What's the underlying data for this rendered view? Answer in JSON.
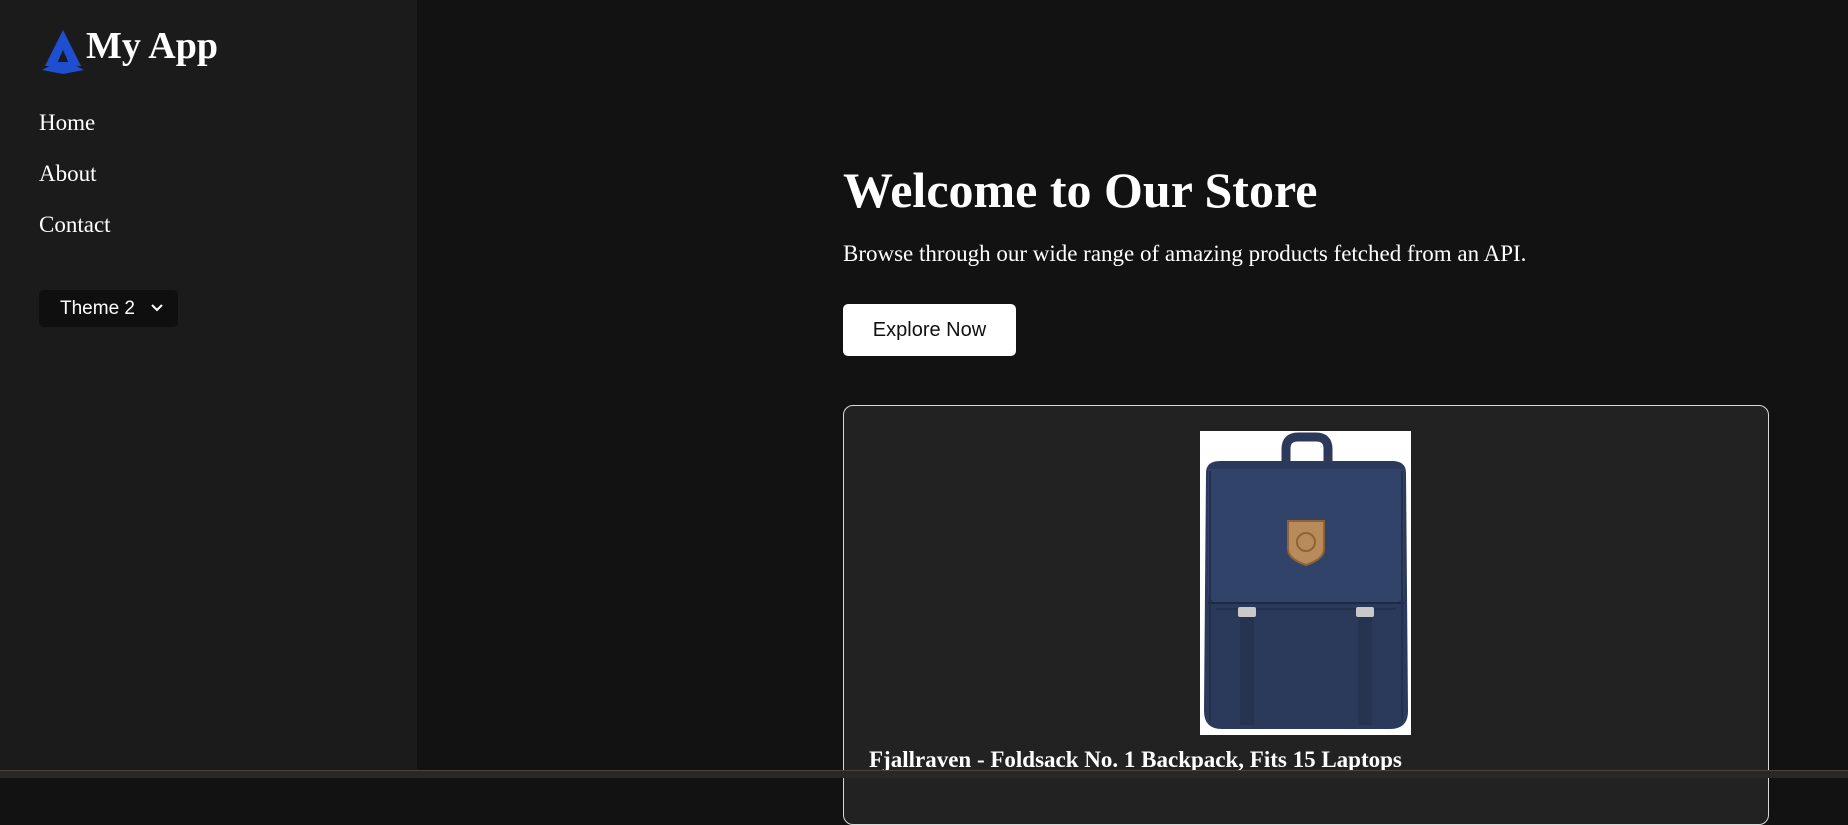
{
  "brand": {
    "title": "My App",
    "accent": "#1f4fd1"
  },
  "nav": {
    "items": [
      {
        "label": "Home"
      },
      {
        "label": "About"
      },
      {
        "label": "Contact"
      }
    ]
  },
  "theme_select": {
    "value": "Theme 2",
    "icon": "chevron-down-icon"
  },
  "hero": {
    "title": "Welcome to Our Store",
    "subtitle": "Browse through our wide range of amazing products fetched from an API.",
    "cta_label": "Explore Now"
  },
  "product": {
    "title": "Fjallraven - Foldsack No. 1 Backpack, Fits 15 Laptops",
    "image": "backpack-image"
  },
  "colors": {
    "sidebar_bg": "#1b1b1b",
    "main_bg": "#121212",
    "card_bg": "#222222",
    "backpack": "#2b3a5a",
    "patch": "#b98a5a"
  }
}
